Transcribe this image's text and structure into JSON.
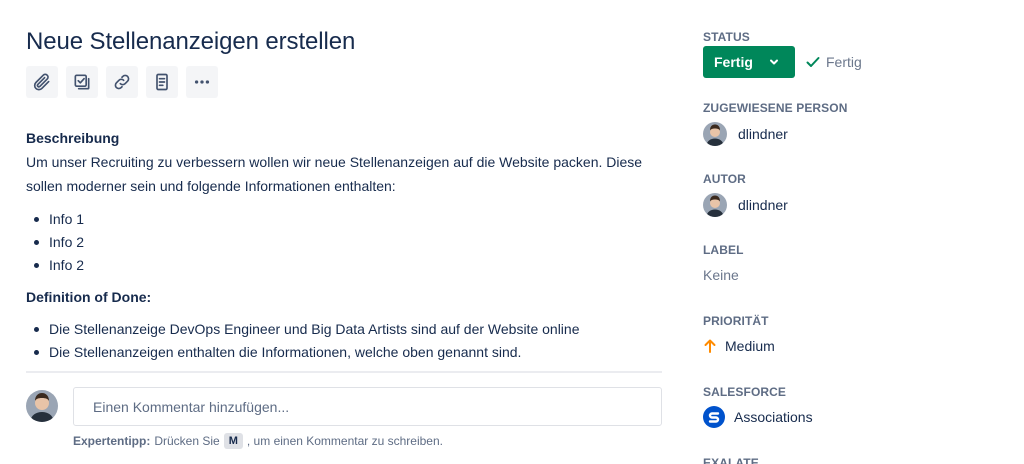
{
  "issue": {
    "title": "Neue Stellenanzeigen erstellen"
  },
  "toolbar": {
    "buttons": [
      {
        "icon": "paperclip-icon",
        "name": "attach-button"
      },
      {
        "icon": "checklist-icon",
        "name": "subtask-button"
      },
      {
        "icon": "link-icon",
        "name": "link-issue-button"
      },
      {
        "icon": "document-icon",
        "name": "page-button"
      },
      {
        "icon": "more-icon",
        "name": "more-button"
      }
    ]
  },
  "description": {
    "heading": "Beschreibung",
    "line1": "Um unser Recruiting zu verbessern wollen wir neue Stellenanzeigen auf die Website packen. Diese",
    "line2": "sollen moderner sein und folgende Informationen enthalten:",
    "items": [
      "Info 1",
      "Info 2",
      "Info 2"
    ],
    "dod_heading": "Definition of Done:",
    "dod_items": [
      "Die Stellenanzeige DevOps Engineer und Big Data Artists sind auf der Website online",
      "Die Stellenanzeigen enthalten die Informationen, welche oben genannt sind."
    ]
  },
  "comment": {
    "placeholder": "Einen Kommentar hinzufügen...",
    "tip_label": "Expertentipp:",
    "tip_before": "Drücken Sie",
    "tip_key": "M",
    "tip_after": ", um einen Kommentar zu schreiben."
  },
  "sidebar": {
    "status_label": "STATUS",
    "status_value": "Fertig",
    "status_resolution": "Fertig",
    "assignee_label": "ZUGEWIESENE PERSON",
    "assignee_name": "dlindner",
    "reporter_label": "AUTOR",
    "reporter_name": "dlindner",
    "labels_label": "LABEL",
    "labels_value": "Keine",
    "priority_label": "PRIORITÄT",
    "priority_value": "Medium",
    "salesforce_label": "SALESFORCE",
    "salesforce_value": "Associations",
    "exalate_label": "EXALATE"
  },
  "colors": {
    "status_green": "#00875a",
    "priority_orange": "#ff8b00",
    "salesforce_blue": "#0052cc",
    "text": "#172b4d",
    "muted": "#5e6c84"
  }
}
